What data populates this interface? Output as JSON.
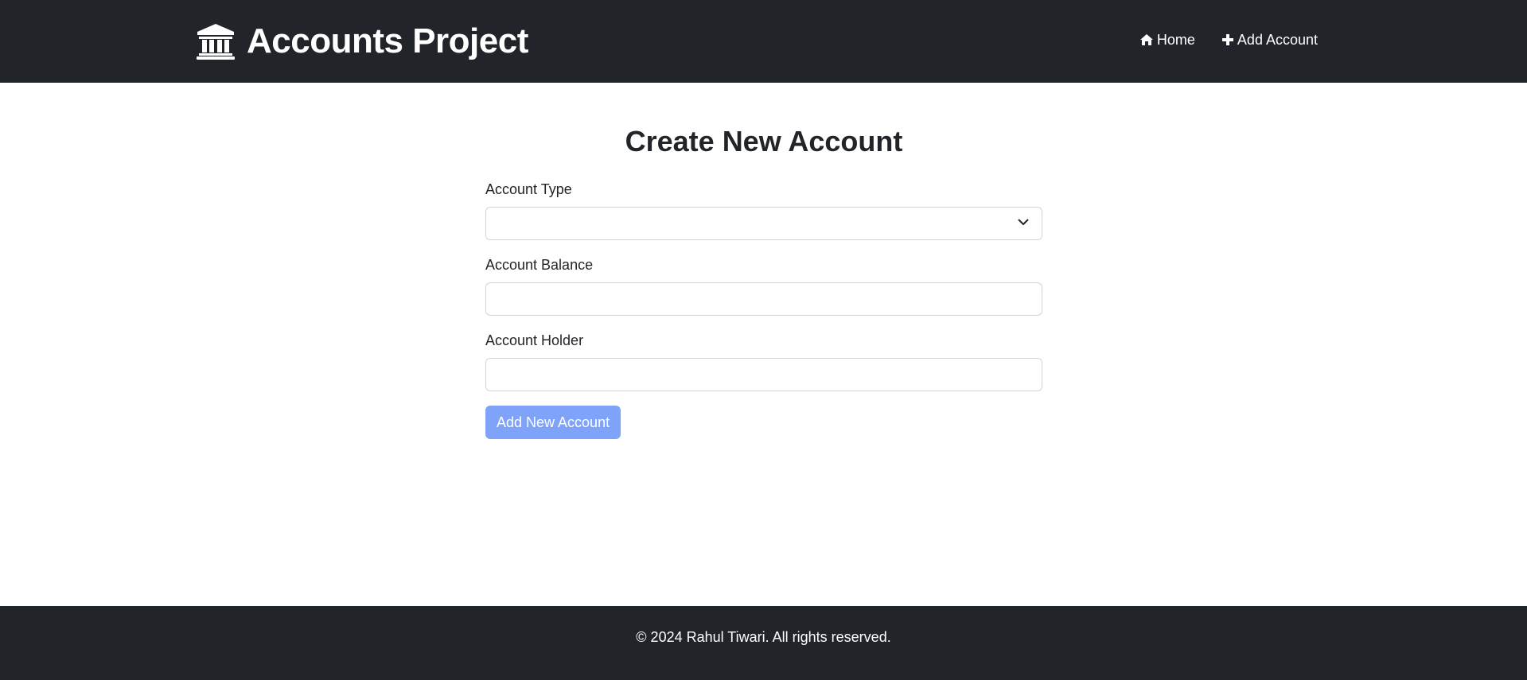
{
  "header": {
    "brand_title": "Accounts Project",
    "brand_icon": "bank-icon",
    "nav": [
      {
        "label": "Home",
        "icon": "home-icon"
      },
      {
        "label": "Add Account",
        "icon": "plus-icon"
      }
    ]
  },
  "main": {
    "title": "Create New Account",
    "fields": {
      "account_type": {
        "label": "Account Type",
        "value": ""
      },
      "account_balance": {
        "label": "Account Balance",
        "value": ""
      },
      "account_holder": {
        "label": "Account Holder",
        "value": ""
      }
    },
    "submit_label": "Add New Account"
  },
  "footer": {
    "text": "© 2024 Rahul Tiwari. All rights reserved."
  },
  "colors": {
    "navbar_bg": "#212529",
    "button_bg": "#7ea3f8",
    "input_border": "#ced4da"
  }
}
